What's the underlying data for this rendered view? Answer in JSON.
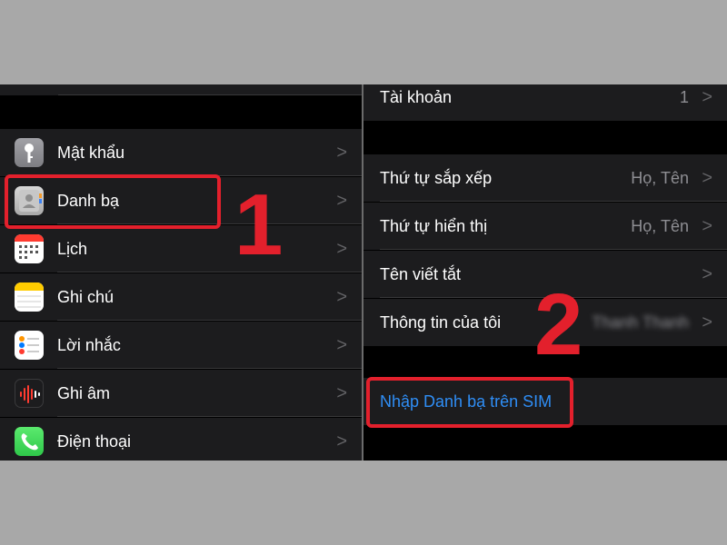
{
  "left_panel": {
    "items": [
      {
        "label": "Mật khẩu",
        "icon": "key-icon"
      },
      {
        "label": "Danh bạ",
        "icon": "contacts-icon"
      },
      {
        "label": "Lịch",
        "icon": "calendar-icon"
      },
      {
        "label": "Ghi chú",
        "icon": "notes-icon"
      },
      {
        "label": "Lời nhắc",
        "icon": "reminders-icon"
      },
      {
        "label": "Ghi âm",
        "icon": "voice-memos-icon"
      },
      {
        "label": "Điện thoại",
        "icon": "phone-icon"
      }
    ],
    "chevron": ">"
  },
  "right_panel": {
    "account": {
      "label": "Tài khoản",
      "value": "1"
    },
    "sort_order": {
      "label": "Thứ tự sắp xếp",
      "value": "Họ, Tên"
    },
    "display_order": {
      "label": "Thứ tự hiển thị",
      "value": "Họ, Tên"
    },
    "short_name": {
      "label": "Tên viết tắt"
    },
    "my_info": {
      "label": "Thông tin của tôi",
      "value": "Thanh Thanh"
    },
    "import_sim": {
      "label": "Nhập Danh bạ trên SIM"
    },
    "chevron": ">"
  },
  "annotations": {
    "step1": "1",
    "step2": "2",
    "highlight_color": "#e3202c"
  },
  "colors": {
    "link": "#2f8ef6",
    "cell_background": "#1c1c1e",
    "background": "#000000"
  }
}
